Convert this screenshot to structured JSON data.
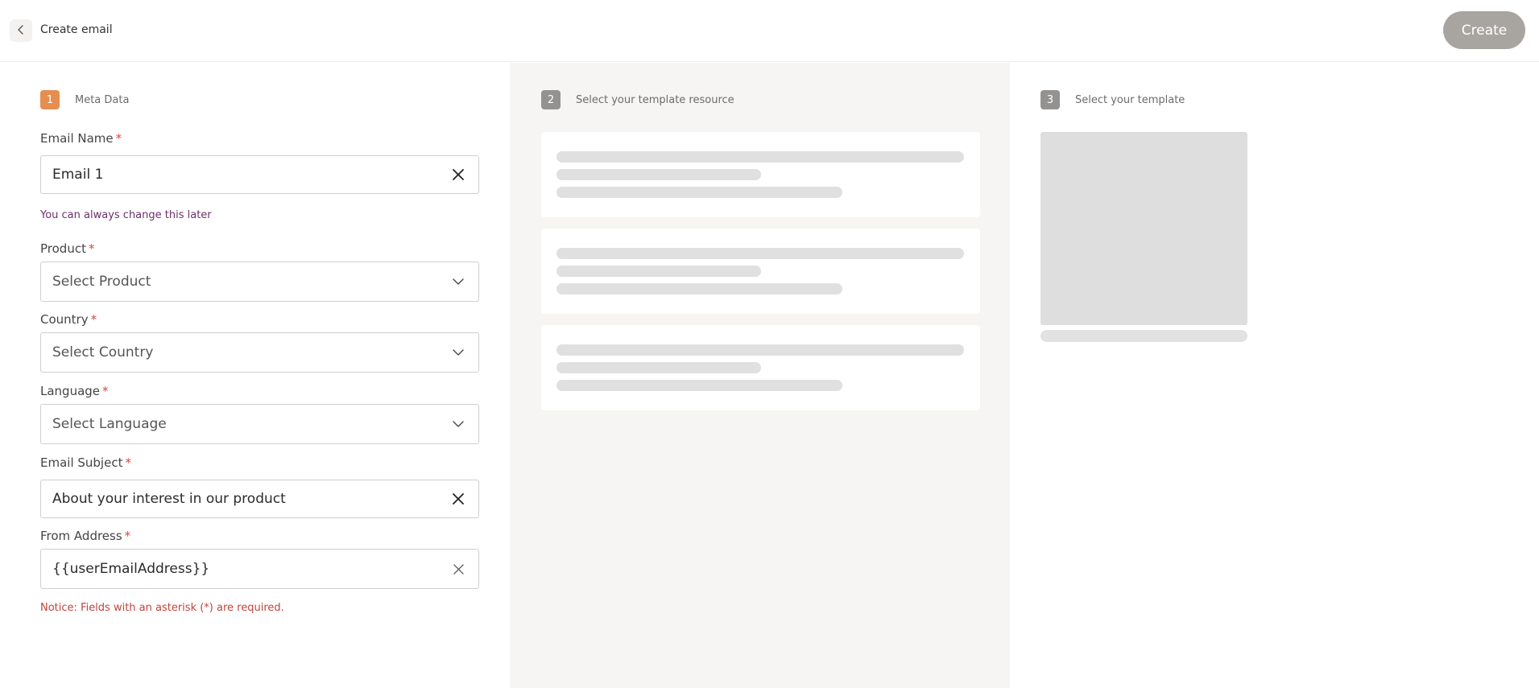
{
  "header": {
    "title": "Create email",
    "create_label": "Create"
  },
  "steps": [
    {
      "number": "1",
      "label": "Meta Data",
      "state": "active"
    },
    {
      "number": "2",
      "label": "Select your template resource",
      "state": "inactive"
    },
    {
      "number": "3",
      "label": "Select your template",
      "state": "inactive"
    }
  ],
  "form": {
    "email_name": {
      "label": "Email Name",
      "required": "*",
      "value": "Email 1",
      "hint": "You can always change this later"
    },
    "product": {
      "label": "Product",
      "required": "*",
      "placeholder": "Select Product"
    },
    "country": {
      "label": "Country",
      "required": "*",
      "placeholder": "Select Country"
    },
    "language": {
      "label": "Language",
      "required": "*",
      "placeholder": "Select Language"
    },
    "email_subject": {
      "label": "Email Subject",
      "required": "*",
      "value": "About your interest in our product"
    },
    "from_address": {
      "label": "From Address",
      "required": "*",
      "value": "{{userEmailAddress}}"
    },
    "notice": "Notice: Fields with an asterisk (*) are required."
  },
  "icons": {
    "back": "chevron-left-icon",
    "clear": "close-icon",
    "dropdown": "chevron-down-icon"
  },
  "colors": {
    "accent": "#e58e50",
    "step_inactive": "#949290",
    "create_button": "#a8a5a1",
    "hint_text": "#6b2f6b",
    "notice_text": "#c0443a",
    "required": "#d9473f"
  }
}
